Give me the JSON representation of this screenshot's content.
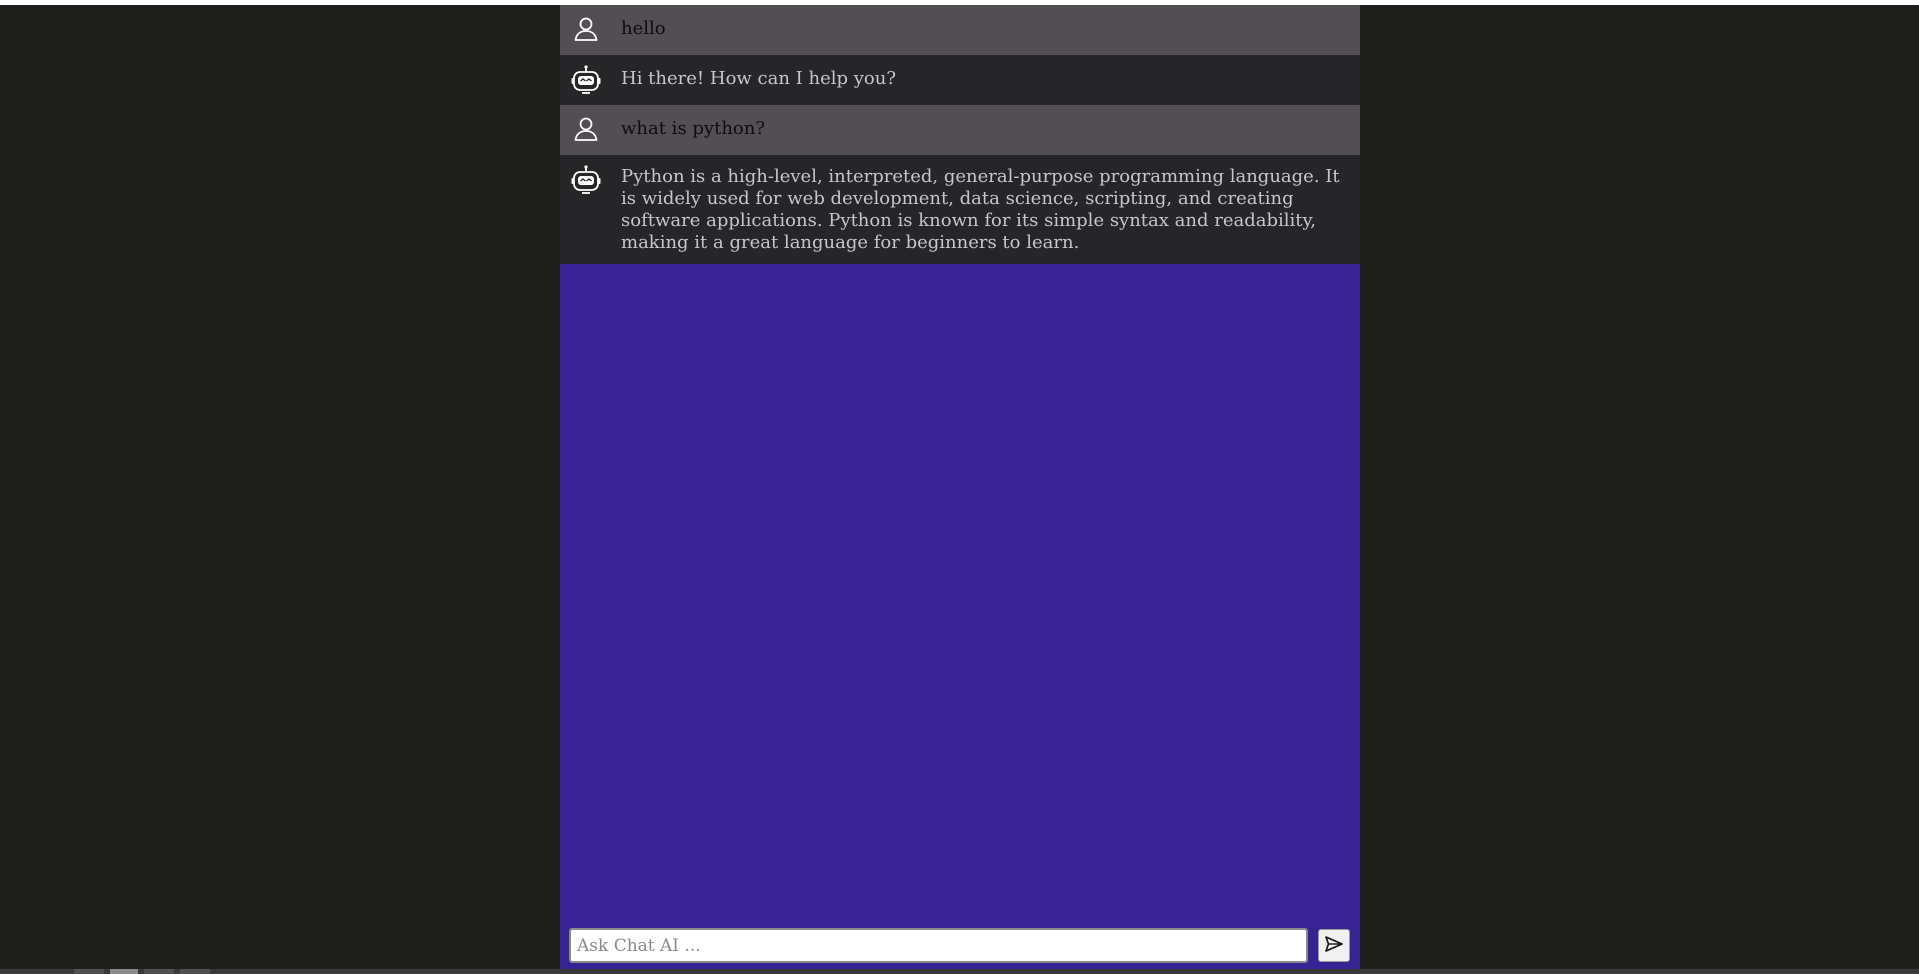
{
  "conversation": [
    {
      "role": "user",
      "avatar_icon": "user-icon",
      "text": "hello"
    },
    {
      "role": "bot",
      "avatar_icon": "robot-icon",
      "text": "Hi there! How can I help you?"
    },
    {
      "role": "user",
      "avatar_icon": "user-icon",
      "text": "what is python?"
    },
    {
      "role": "bot",
      "avatar_icon": "robot-icon",
      "text": "Python is a high-level, interpreted, general-purpose programming language. It is widely used for web development, data science, scripting, and creating software applications. Python is known for its simple syntax and readability, making it a great language for beginners to learn."
    }
  ],
  "composer": {
    "placeholder": "Ask Chat AI ...",
    "value": "",
    "send_icon": "send-icon"
  },
  "colors": {
    "page_background": "#1f1f1e",
    "chat_background": "#372394",
    "user_message_background": "#524e54",
    "bot_message_background": "#262528"
  }
}
